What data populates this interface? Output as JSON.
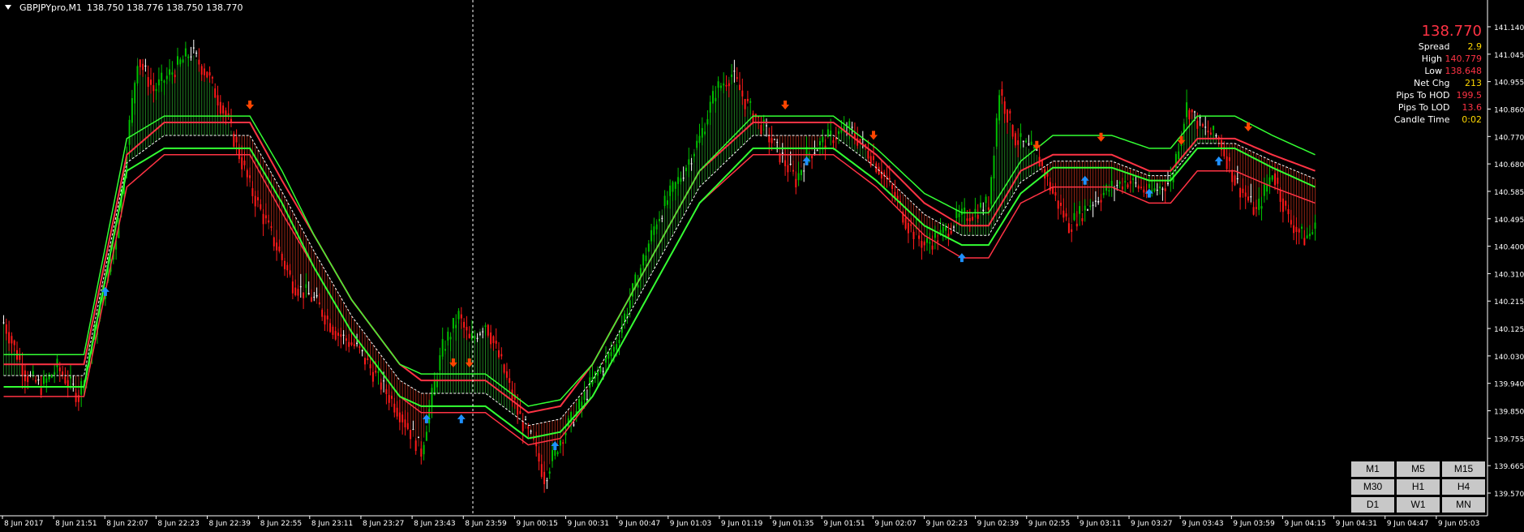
{
  "header": {
    "symbol": "GBPJPYpro,M1",
    "ohlc": "138.750 138.776 138.750 138.770"
  },
  "info": {
    "price": "138.770",
    "rows": [
      {
        "label": "Spread",
        "value": "2.9",
        "color": "#ffd700"
      },
      {
        "label": "High",
        "value": "140.779",
        "color": "#ff3344"
      },
      {
        "label": "Low",
        "value": "138.648",
        "color": "#ff3344"
      },
      {
        "label": "Net Chg",
        "value": "213",
        "color": "#ffd700"
      },
      {
        "label": "Pips To HOD",
        "value": "199.5",
        "color": "#ff3344"
      },
      {
        "label": "Pips To LOD",
        "value": "13.6",
        "color": "#ff3344"
      },
      {
        "label": "Candle Time",
        "value": "0:02",
        "color": "#ffd700"
      }
    ]
  },
  "timeframes": [
    "M1",
    "M5",
    "M15",
    "M30",
    "H1",
    "H4",
    "D1",
    "W1",
    "MN"
  ],
  "colors": {
    "background": "#000000",
    "bull": "#00c000",
    "bear": "#ff1a1a",
    "neutral": "#ffffff",
    "upper_band": "#ff3344",
    "lower_band": "#33ff33",
    "mid_line": "#ffffff",
    "up_arrow": "#1e90ff",
    "down_arrow": "#ff4500",
    "axis": "#ffffff"
  },
  "chart_data": {
    "type": "candlestick",
    "ylim": [
      139.58,
      141.18
    ],
    "y_ticks": [
      "141.140",
      "141.045",
      "140.955",
      "140.860",
      "140.770",
      "140.680",
      "140.585",
      "140.495",
      "140.400",
      "140.310",
      "140.215",
      "140.125",
      "140.030",
      "139.940",
      "139.850",
      "139.755",
      "139.665",
      "139.570"
    ],
    "x_ticks": [
      "8 Jun 2017",
      "8 Jun 21:51",
      "8 Jun 22:07",
      "8 Jun 22:23",
      "8 Jun 22:39",
      "8 Jun 22:55",
      "8 Jun 23:11",
      "8 Jun 23:27",
      "8 Jun 23:43",
      "8 Jun 23:59",
      "9 Jun 00:15",
      "9 Jun 00:31",
      "9 Jun 00:47",
      "9 Jun 01:03",
      "9 Jun 01:19",
      "9 Jun 01:35",
      "9 Jun 01:51",
      "9 Jun 02:07",
      "9 Jun 02:23",
      "9 Jun 02:39",
      "9 Jun 02:55",
      "9 Jun 03:11",
      "9 Jun 03:27",
      "9 Jun 03:43",
      "9 Jun 03:59",
      "9 Jun 04:15",
      "9 Jun 04:31",
      "9 Jun 04:47",
      "9 Jun 05:03"
    ],
    "bars_per_tick": 16,
    "price_path": [
      [
        0,
        140.18
      ],
      [
        8,
        140.02
      ],
      [
        14,
        139.98
      ],
      [
        20,
        140.04
      ],
      [
        28,
        139.95
      ],
      [
        34,
        140.15
      ],
      [
        42,
        140.45
      ],
      [
        50,
        141.0
      ],
      [
        56,
        140.9
      ],
      [
        62,
        140.95
      ],
      [
        70,
        141.02
      ],
      [
        76,
        140.95
      ],
      [
        84,
        140.8
      ],
      [
        92,
        140.6
      ],
      [
        100,
        140.45
      ],
      [
        108,
        140.3
      ],
      [
        116,
        140.25
      ],
      [
        124,
        140.15
      ],
      [
        132,
        140.1
      ],
      [
        140,
        140.0
      ],
      [
        148,
        139.9
      ],
      [
        156,
        139.78
      ],
      [
        160,
        139.95
      ],
      [
        164,
        140.1
      ],
      [
        170,
        140.2
      ],
      [
        174,
        140.12
      ],
      [
        180,
        140.18
      ],
      [
        186,
        140.05
      ],
      [
        192,
        139.9
      ],
      [
        198,
        139.8
      ],
      [
        202,
        139.7
      ],
      [
        208,
        139.82
      ],
      [
        214,
        139.9
      ],
      [
        220,
        140.0
      ],
      [
        228,
        140.1
      ],
      [
        236,
        140.3
      ],
      [
        244,
        140.5
      ],
      [
        252,
        140.62
      ],
      [
        260,
        140.75
      ],
      [
        266,
        140.9
      ],
      [
        272,
        140.95
      ],
      [
        278,
        140.85
      ],
      [
        284,
        140.78
      ],
      [
        290,
        140.7
      ],
      [
        296,
        140.62
      ],
      [
        300,
        140.7
      ],
      [
        308,
        140.75
      ],
      [
        316,
        140.78
      ],
      [
        322,
        140.72
      ],
      [
        330,
        140.62
      ],
      [
        338,
        140.48
      ],
      [
        344,
        140.42
      ],
      [
        350,
        140.45
      ],
      [
        356,
        140.5
      ],
      [
        362,
        140.52
      ],
      [
        368,
        140.55
      ],
      [
        372,
        140.9
      ],
      [
        378,
        140.75
      ],
      [
        386,
        140.7
      ],
      [
        392,
        140.58
      ],
      [
        398,
        140.48
      ],
      [
        406,
        140.55
      ],
      [
        414,
        140.6
      ],
      [
        420,
        140.62
      ],
      [
        428,
        140.58
      ],
      [
        436,
        140.62
      ],
      [
        442,
        140.85
      ],
      [
        448,
        140.78
      ],
      [
        454,
        140.75
      ],
      [
        460,
        140.62
      ],
      [
        468,
        140.52
      ],
      [
        474,
        140.65
      ],
      [
        480,
        140.5
      ],
      [
        486,
        140.44
      ],
      [
        490,
        140.47
      ]
    ],
    "upper_band": [
      [
        0,
        140.05
      ],
      [
        30,
        140.05
      ],
      [
        46,
        140.7
      ],
      [
        60,
        140.8
      ],
      [
        92,
        140.8
      ],
      [
        104,
        140.62
      ],
      [
        116,
        140.45
      ],
      [
        130,
        140.25
      ],
      [
        148,
        140.05
      ],
      [
        156,
        140.0
      ],
      [
        180,
        140.0
      ],
      [
        196,
        139.9
      ],
      [
        208,
        139.92
      ],
      [
        220,
        140.05
      ],
      [
        240,
        140.35
      ],
      [
        260,
        140.65
      ],
      [
        280,
        140.8
      ],
      [
        296,
        140.8
      ],
      [
        310,
        140.8
      ],
      [
        326,
        140.7
      ],
      [
        344,
        140.55
      ],
      [
        358,
        140.48
      ],
      [
        368,
        140.48
      ],
      [
        380,
        140.65
      ],
      [
        392,
        140.7
      ],
      [
        414,
        140.7
      ],
      [
        428,
        140.65
      ],
      [
        436,
        140.65
      ],
      [
        446,
        140.75
      ],
      [
        460,
        140.75
      ],
      [
        474,
        140.7
      ],
      [
        490,
        140.65
      ]
    ],
    "lower_band": [
      [
        0,
        139.98
      ],
      [
        30,
        139.98
      ],
      [
        46,
        140.65
      ],
      [
        60,
        140.72
      ],
      [
        92,
        140.72
      ],
      [
        104,
        140.55
      ],
      [
        116,
        140.35
      ],
      [
        130,
        140.15
      ],
      [
        148,
        139.95
      ],
      [
        156,
        139.92
      ],
      [
        180,
        139.92
      ],
      [
        196,
        139.82
      ],
      [
        208,
        139.84
      ],
      [
        220,
        139.95
      ],
      [
        240,
        140.25
      ],
      [
        260,
        140.55
      ],
      [
        280,
        140.72
      ],
      [
        296,
        140.72
      ],
      [
        310,
        140.72
      ],
      [
        326,
        140.62
      ],
      [
        344,
        140.48
      ],
      [
        358,
        140.42
      ],
      [
        368,
        140.42
      ],
      [
        380,
        140.58
      ],
      [
        392,
        140.66
      ],
      [
        414,
        140.66
      ],
      [
        428,
        140.62
      ],
      [
        436,
        140.62
      ],
      [
        446,
        140.72
      ],
      [
        460,
        140.72
      ],
      [
        474,
        140.66
      ],
      [
        490,
        140.6
      ]
    ],
    "up_arrows": [
      38,
      158,
      171,
      206,
      300,
      358,
      404,
      428,
      454
    ],
    "down_arrows": [
      92,
      168,
      174,
      292,
      325,
      386,
      410,
      440,
      465
    ]
  }
}
